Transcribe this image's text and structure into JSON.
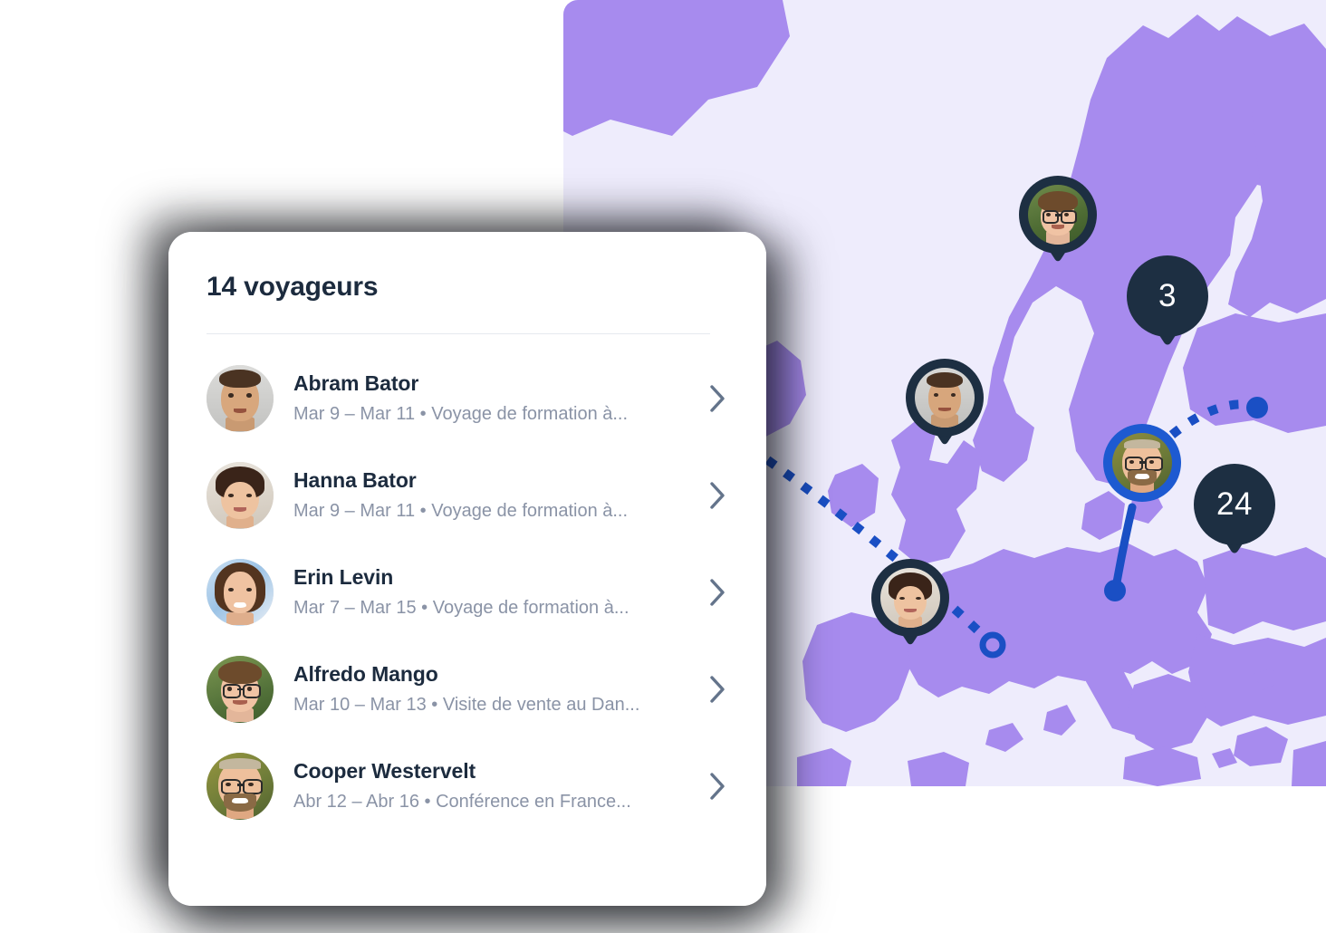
{
  "card": {
    "title": "14 voyageurs",
    "travelers": [
      {
        "name": "Abram Bator",
        "details": "Mar 9 – Mar 11 • Voyage de formation à...",
        "avatar": "avatar-abram-bator",
        "chevron_icon": "chevron-right-icon"
      },
      {
        "name": "Hanna Bator",
        "details": "Mar 9 – Mar 11 • Voyage de formation à...",
        "avatar": "avatar-hanna-bator",
        "chevron_icon": "chevron-right-icon"
      },
      {
        "name": "Erin Levin",
        "details": "Mar 7 – Mar 15 • Voyage de formation à...",
        "avatar": "avatar-erin-levin",
        "chevron_icon": "chevron-right-icon"
      },
      {
        "name": "Alfredo Mango",
        "details": "Mar 10 – Mar 13 • Visite de vente au Dan...",
        "avatar": "avatar-alfredo-mango",
        "chevron_icon": "chevron-right-icon"
      },
      {
        "name": "Cooper Westervelt",
        "details": "Abr 12 – Abr 16 • Conférence en France...",
        "avatar": "avatar-cooper-westervelt",
        "chevron_icon": "chevron-right-icon"
      }
    ]
  },
  "map": {
    "background_color": "#EEECFC",
    "land_color": "#A78BEE",
    "pin_color": "#1D2F42",
    "active_pin_color": "#1D5AD1",
    "route_color": "#1A4FC4",
    "avatar_pins": [
      {
        "name": "pin-avatar-scandinavia",
        "avatar": "avatar-alfredo-mango",
        "active": false
      },
      {
        "name": "pin-avatar-britain",
        "avatar": "avatar-abram-bator",
        "active": false
      },
      {
        "name": "pin-avatar-iberia",
        "avatar": "avatar-hanna-bator",
        "active": false
      },
      {
        "name": "pin-avatar-central-europe",
        "avatar": "avatar-cooper-westervelt",
        "active": true
      }
    ],
    "count_pins": [
      {
        "name": "pin-count-baltic",
        "count": "3"
      },
      {
        "name": "pin-count-alps",
        "count": "24"
      }
    ]
  }
}
